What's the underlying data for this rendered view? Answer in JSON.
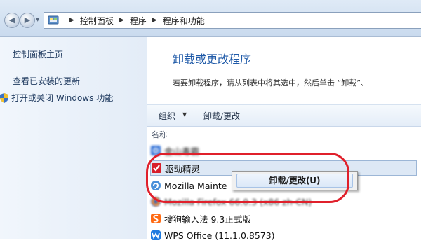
{
  "window": {
    "breadcrumb": [
      "控制面板",
      "程序",
      "程序和功能"
    ]
  },
  "sidebar": {
    "items": [
      {
        "label": "控制面板主页"
      },
      {
        "label": "查看已安装的更新"
      },
      {
        "label": "打开或关闭 Windows 功能"
      }
    ]
  },
  "main": {
    "title": "卸载或更改程序",
    "description": "若要卸载程序，请从列表中将其选中，然后单击 “卸载”、"
  },
  "toolbar": {
    "organize_label": "组织",
    "uninstall_label": "卸载/更改"
  },
  "list": {
    "column_name": "名称",
    "programs": [
      {
        "name": "金山毒霸",
        "icon": "kingsoft-antivirus-icon"
      },
      {
        "name": "驱动精灵",
        "icon": "drive-genius-icon",
        "selected": true
      },
      {
        "name": "Mozilla Mainte",
        "icon": "mozilla-maintenance-icon"
      },
      {
        "name": "Mozilla Firefox 66.0.3 (x86 zh-CN)",
        "icon": "firefox-icon"
      },
      {
        "name": "搜狗输入法 9.3正式版",
        "icon": "sogou-input-icon"
      },
      {
        "name": "WPS Office (11.1.0.8573)",
        "icon": "wps-office-icon"
      }
    ]
  },
  "context_menu": {
    "items": [
      {
        "label": "卸载/更改(U)"
      }
    ]
  },
  "colors": {
    "link": "#1f3a5f",
    "title": "#1f5aa8",
    "annotation": "#e0202b",
    "selection": "#dde8f5"
  }
}
